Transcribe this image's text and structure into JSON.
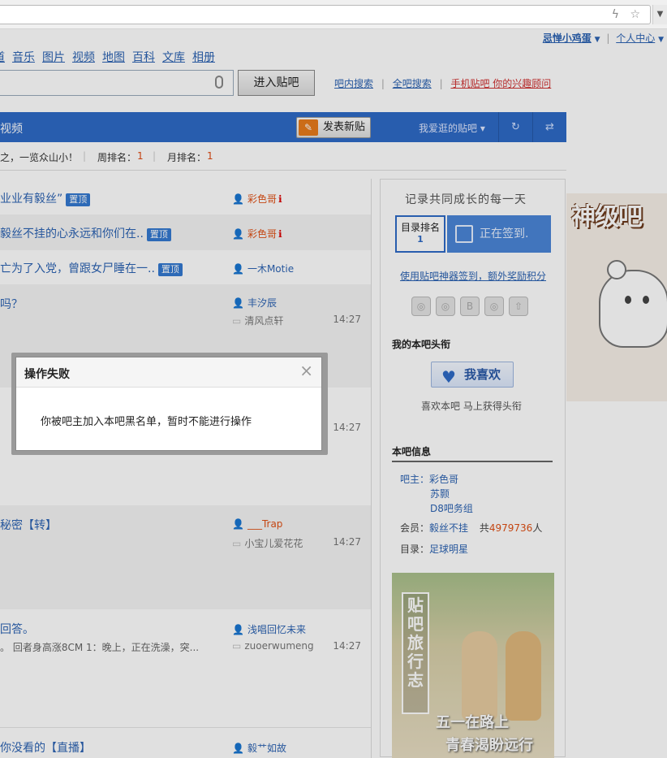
{
  "browser": {
    "lightning_icon": "lightning-icon",
    "star_icon": "star-icon",
    "scroll_arrow": "▼"
  },
  "user": {
    "name": "忌惮小鸡蛋",
    "center": "个人中心",
    "arrow": "▼"
  },
  "nav": [
    "道",
    "音乐",
    "图片",
    "视频",
    "地图",
    "百科",
    "文库",
    "相册"
  ],
  "search": {
    "enter_label": "进入贴吧",
    "link_in": "吧内搜索",
    "link_all": "全吧搜索",
    "link_mobile": "手机贴吧 你的兴趣顾问"
  },
  "forumbar": {
    "title": "视频",
    "post_label": "发表新贴",
    "fav_label": "我爱逛的贴吧 ▾",
    "refresh_icon": "↻",
    "switch_icon": "⇄"
  },
  "rank": {
    "slogan": "之，一览众山小！",
    "week_label": "周排名：",
    "week_val": "1",
    "month_label": "月排名：",
    "month_val": "1"
  },
  "threads": [
    {
      "title": "业业有毅丝”",
      "tag": "置顶",
      "author": "彩色哥",
      "author_badge": "ℹ"
    },
    {
      "title": "毅丝不挂的心永远和你们在..",
      "tag": "置顶",
      "author": "彩色哥",
      "author_badge": "ℹ"
    },
    {
      "title": "亡为了入党，曾跟女尸睡在一..",
      "tag": "置顶",
      "author": "一木Motie"
    },
    {
      "title": "吗？",
      "author": "丰汐辰",
      "replier": "清风点轩",
      "time": "14:27"
    },
    {
      "time": "14:27"
    },
    {
      "title": "秘密【转】",
      "author": "___Trap",
      "replier": "小宝儿爱花花",
      "time": "14:27"
    },
    {
      "title": "回答。",
      "sub": "。 回者身高涨8CM 1：晚上，正在洗澡，突...",
      "author": "浅唱回忆未来",
      "replier": "zuoerwumeng",
      "time": "14:27"
    },
    {
      "title": "你没看的【直播】",
      "author": "毅艹如故"
    }
  ],
  "side": {
    "motto": "记录共同成长的每一天",
    "rank_label": "目录排名",
    "rank_value": "1",
    "sign_label": "正在签到.",
    "promo": "使用贴吧神器签到，额外奖励积分",
    "headline_title": "我的本吧头衔",
    "like_label": "我喜欢",
    "like_hint": "喜欢本吧  马上获得头衔",
    "info_title": "本吧信息",
    "owner_label": "吧主：",
    "owners": [
      "彩色哥",
      "苏颢",
      "D8吧务组"
    ],
    "member_label": "会员：",
    "member_name": "毅丝不挂",
    "member_count_pre": "共",
    "member_count": "4979736",
    "member_count_post": "人",
    "catalog_label": "目录：",
    "catalog": "足球明星",
    "poster_v": "贴吧旅行志",
    "poster_line1": "五一在路上",
    "poster_line2": "青春渴盼远行"
  },
  "ad": {
    "banner": "神级吧"
  },
  "dialog": {
    "title": "操作失败",
    "message": "你被吧主加入本吧黑名单，暂时不能进行操作",
    "close": "×"
  }
}
